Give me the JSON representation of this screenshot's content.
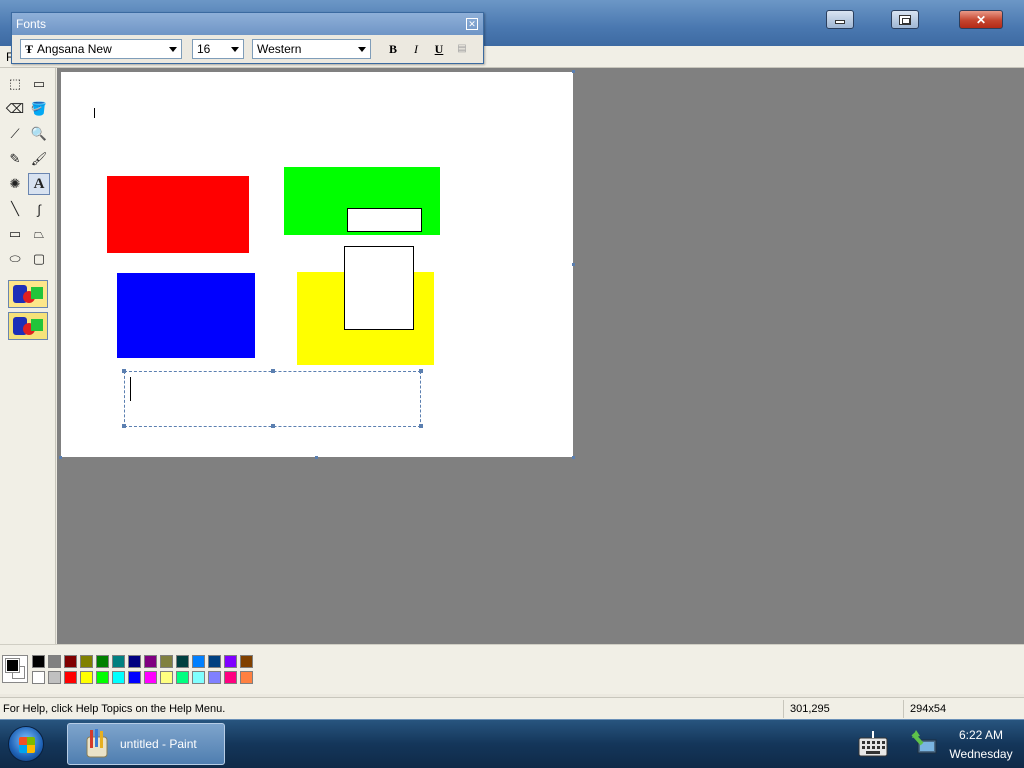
{
  "window": {
    "minimize_label": "Minimize",
    "maximize_label": "Restore",
    "close_glyph": "✕",
    "menu_first": "F"
  },
  "fonts_toolbar": {
    "title": "Fonts",
    "close_glyph": "✕",
    "font_name": "Angsana New",
    "font_size": "16",
    "script": "Western",
    "bold_label": "B",
    "italic_label": "I",
    "underline_label": "U"
  },
  "tools": [
    {
      "name": "free-form-select-icon",
      "glyph": "⬚"
    },
    {
      "name": "select-icon",
      "glyph": "▭"
    },
    {
      "name": "eraser-icon",
      "glyph": "⌫"
    },
    {
      "name": "fill-with-color-icon",
      "glyph": "🪣"
    },
    {
      "name": "pick-color-icon",
      "glyph": "⟋"
    },
    {
      "name": "magnifier-icon",
      "glyph": "🔍"
    },
    {
      "name": "pencil-icon",
      "glyph": "✎"
    },
    {
      "name": "brush-icon",
      "glyph": "🖌"
    },
    {
      "name": "airbrush-icon",
      "glyph": "✺"
    },
    {
      "name": "text-icon",
      "glyph": "A"
    },
    {
      "name": "line-icon",
      "glyph": "╲"
    },
    {
      "name": "curve-icon",
      "glyph": "∫"
    },
    {
      "name": "rectangle-icon",
      "glyph": "▭"
    },
    {
      "name": "polygon-icon",
      "glyph": "⏢"
    },
    {
      "name": "ellipse-icon",
      "glyph": "⬭"
    },
    {
      "name": "rounded-rectangle-icon",
      "glyph": "▢"
    }
  ],
  "active_tool": "text-icon",
  "canvas": {
    "shape_colors": {
      "red": "#ff0000",
      "green": "#00ff00",
      "blue": "#0000ff",
      "yellow": "#ffff00"
    }
  },
  "palette": {
    "foreground": "#000000",
    "background": "#ffffff",
    "row1": [
      "#000000",
      "#808080",
      "#800000",
      "#808000",
      "#008000",
      "#008080",
      "#000080",
      "#800080",
      "#808040",
      "#004040",
      "#0080ff",
      "#004080",
      "#8000ff",
      "#804000"
    ],
    "row2": [
      "#ffffff",
      "#c0c0c0",
      "#ff0000",
      "#ffff00",
      "#00ff00",
      "#00ffff",
      "#0000ff",
      "#ff00ff",
      "#ffff80",
      "#00ff80",
      "#80ffff",
      "#8080ff",
      "#ff0080",
      "#ff8040"
    ]
  },
  "status": {
    "help": "For Help, click Help Topics on the Help Menu.",
    "coords": "301,295",
    "size": "294x54"
  },
  "taskbar": {
    "task_label": "untitled - Paint",
    "time": "6:22 AM",
    "day": "Wednesday"
  }
}
